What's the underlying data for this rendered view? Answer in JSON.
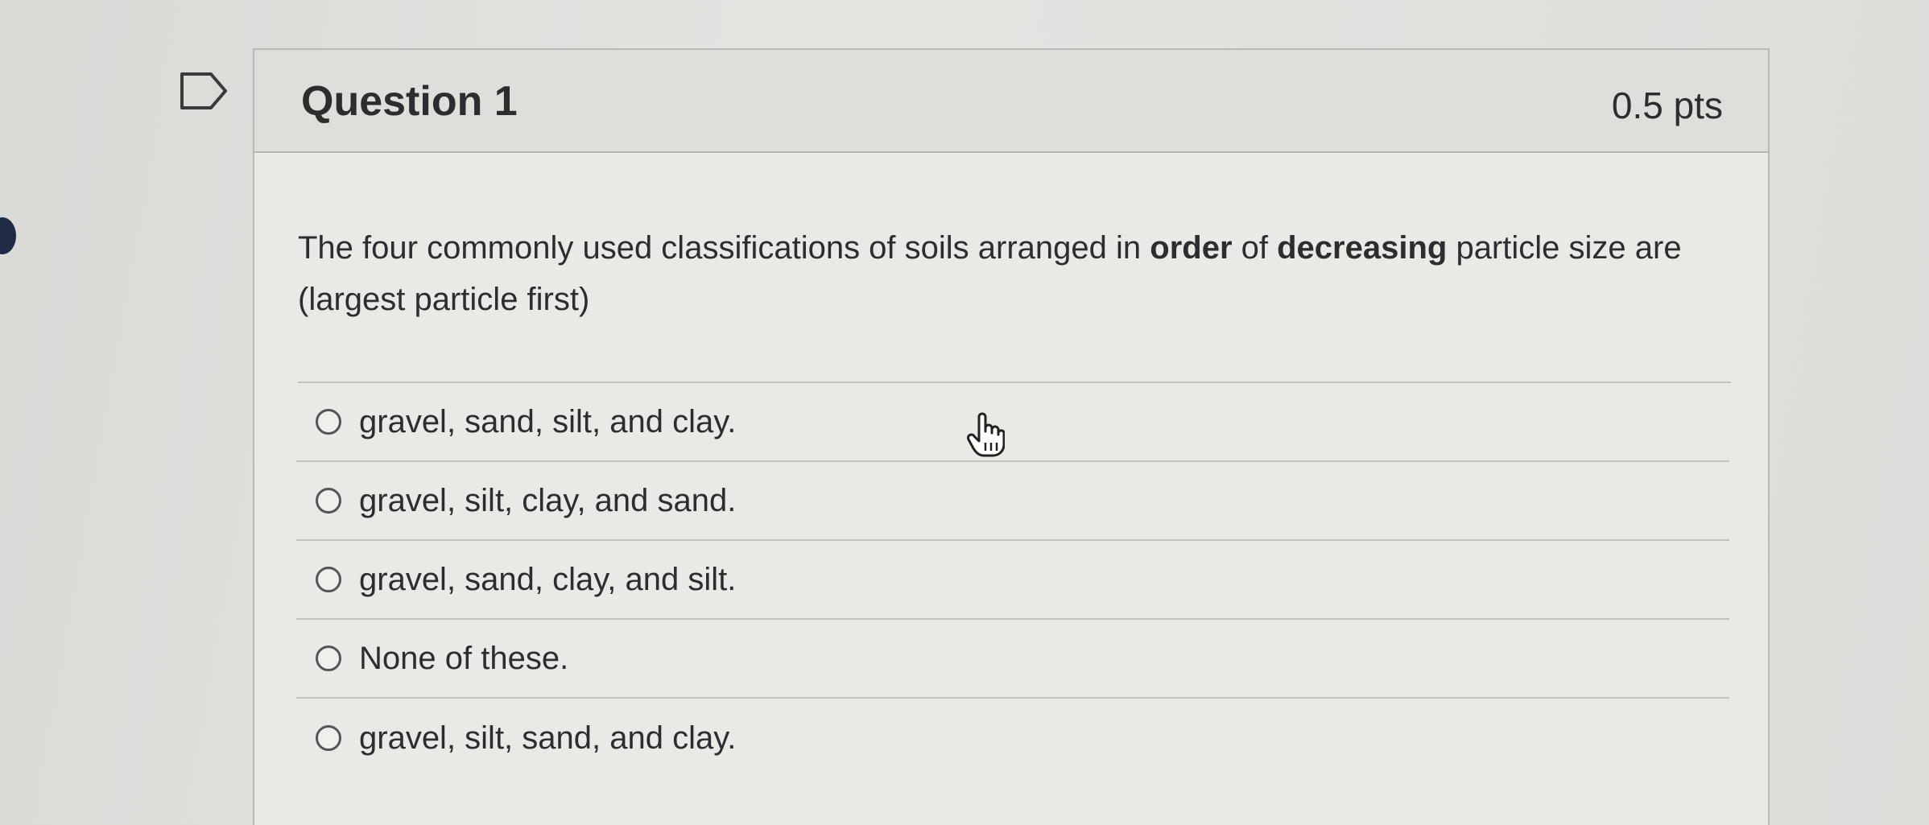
{
  "question": {
    "title": "Question 1",
    "points": "0.5 pts",
    "text_before_order": "The four commonly used classifications of soils arranged in ",
    "text_order": "order",
    "text_of": " of ",
    "text_decreasing": "decreasing",
    "text_after": " particle size are (largest particle first)"
  },
  "answers": [
    {
      "label": "gravel, sand, silt, and clay.",
      "selected": false
    },
    {
      "label": "gravel, silt, clay, and sand.",
      "selected": false
    },
    {
      "label": "gravel, sand, clay, and silt.",
      "selected": false
    },
    {
      "label": "None of these.",
      "selected": false
    },
    {
      "label": "gravel, silt, sand, and clay.",
      "selected": false
    }
  ],
  "icons": {
    "flag": "flag-outline-icon",
    "cursor": "hand-pointer-icon"
  },
  "colors": {
    "text": "#2d2d2d",
    "header_bg": "#dededb",
    "card_bg": "#e9e9e6"
  }
}
